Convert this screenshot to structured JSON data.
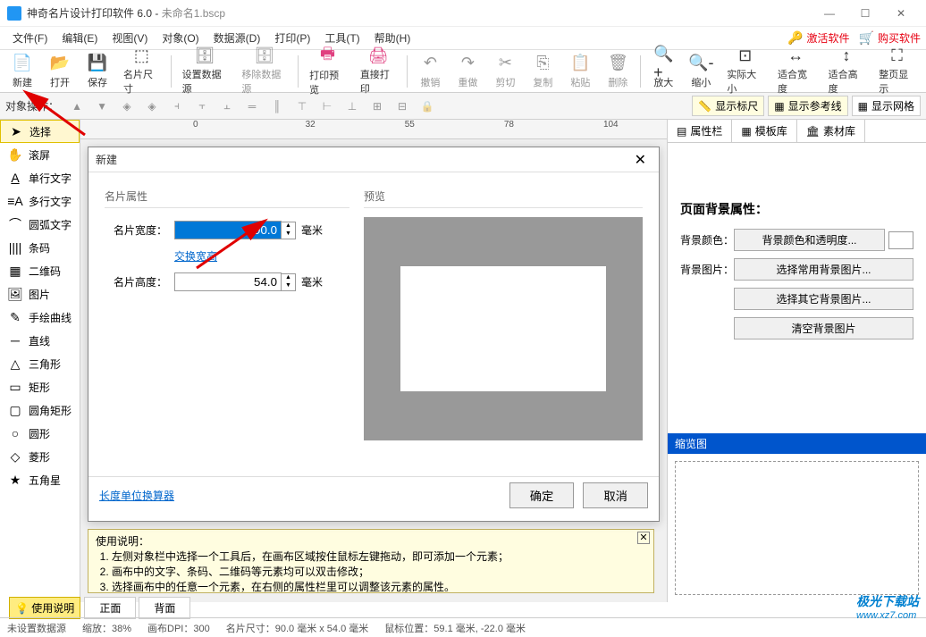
{
  "window": {
    "title": "神奇名片设计打印软件 6.0 - ",
    "document": "未命名1.bscp"
  },
  "menu": {
    "file": "文件(F)",
    "edit": "编辑(E)",
    "view": "视图(V)",
    "object": "对象(O)",
    "datasource": "数据源(D)",
    "print": "打印(P)",
    "tools": "工具(T)",
    "help": "帮助(H)",
    "activate": "激活软件",
    "buy": "购买软件"
  },
  "toolbar": {
    "new": "新建",
    "open": "打开",
    "save": "保存",
    "cardsize": "名片尺寸",
    "setds": "设置数据源",
    "removeds": "移除数据源",
    "preview": "打印预览",
    "printnow": "直接打印",
    "undo": "撤销",
    "redo": "重做",
    "cut": "剪切",
    "copy": "复制",
    "paste": "粘贴",
    "delete": "删除",
    "zoomin": "放大",
    "zoomout": "缩小",
    "actualsize": "实际大小",
    "fitwidth": "适合宽度",
    "fitheight": "适合高度",
    "fitpage": "整页显示"
  },
  "sectoolbar": {
    "label": "对象操作：",
    "ruler": "显示标尺",
    "guides": "显示参考线",
    "grid": "显示网格"
  },
  "ruler": {
    "t0": "0",
    "t1": "32",
    "t2": "55",
    "t3": "78",
    "t4": "104"
  },
  "tools": {
    "select": "选择",
    "pan": "滚屏",
    "textline": "单行文字",
    "textmulti": "多行文字",
    "arctext": "圆弧文字",
    "barcode": "条码",
    "qrcode": "二维码",
    "image": "图片",
    "freehand": "手绘曲线",
    "line": "直线",
    "triangle": "三角形",
    "rect": "矩形",
    "roundrect": "圆角矩形",
    "ellipse": "圆形",
    "diamond": "菱形",
    "star": "五角星"
  },
  "rightpanel": {
    "tab_props": "属性栏",
    "tab_templates": "模板库",
    "tab_assets": "素材库",
    "bg_title": "页面背景属性：",
    "bg_color_label": "背景颜色：",
    "bg_color_btn": "背景颜色和透明度...",
    "bg_image_label": "背景图片：",
    "bg_common_btn": "选择常用背景图片...",
    "bg_other_btn": "选择其它背景图片...",
    "bg_clear_btn": "清空背景图片",
    "overview": "缩览图"
  },
  "dialog": {
    "title": "新建",
    "group_props": "名片属性",
    "group_preview": "预览",
    "width_label": "名片宽度：",
    "width_value": "90.0",
    "unit": "毫米",
    "swap": "交换宽高",
    "height_label": "名片高度：",
    "height_value": "54.0",
    "unit_converter": "长度单位换算器",
    "ok": "确定",
    "cancel": "取消"
  },
  "instructions": {
    "title": "使用说明：",
    "i1": "左侧对象栏中选择一个工具后，在画布区域按住鼠标左键拖动，即可添加一个元素；",
    "i2": "画布中的文字、条码、二维码等元素均可以双击修改；",
    "i3": "选择画布中的任意一个元素，在右侧的属性栏里可以调整该元素的属性。",
    "tab_label": "使用说明"
  },
  "bottom": {
    "front": "正面",
    "back": "背面"
  },
  "status": {
    "ds": "未设置数据源",
    "zoom": "缩放：38%",
    "dpi": "画布DPI：300",
    "size": "名片尺寸：90.0 毫米 x 54.0 毫米",
    "pos": "鼠标位置：59.1 毫米, -22.0 毫米"
  },
  "watermark": {
    "line1": "极光下载站",
    "line2": "www.xz7.com"
  }
}
